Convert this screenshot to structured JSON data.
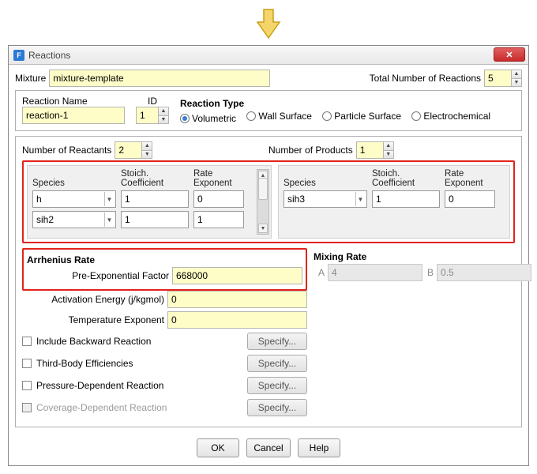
{
  "window": {
    "title": "Reactions",
    "icon_letter": "F"
  },
  "top": {
    "mixture_label": "Mixture",
    "mixture_value": "mixture-template",
    "total_label": "Total Number of Reactions",
    "total_value": "5"
  },
  "reaction": {
    "name_label": "Reaction Name",
    "name_value": "reaction-1",
    "id_label": "ID",
    "id_value": "1",
    "type_label": "Reaction Type",
    "types": {
      "volumetric": "Volumetric",
      "wall": "Wall Surface",
      "particle": "Particle Surface",
      "electro": "Electrochemical"
    }
  },
  "counts": {
    "reactants_label": "Number of Reactants",
    "reactants_value": "2",
    "products_label": "Number of Products",
    "products_value": "1"
  },
  "columns": {
    "species": "Species",
    "stoich": "Stoich.\nCoefficient",
    "rate": "Rate\nExponent",
    "stoich_l1": "Stoich.",
    "stoich_l2": "Coefficient",
    "rate_l1": "Rate",
    "rate_l2": "Exponent"
  },
  "reactants": [
    {
      "species": "h",
      "coeff": "1",
      "exp": "0"
    },
    {
      "species": "sih2",
      "coeff": "1",
      "exp": "1"
    }
  ],
  "products": [
    {
      "species": "sih3",
      "coeff": "1",
      "exp": "0"
    }
  ],
  "arrhenius": {
    "title": "Arrhenius Rate",
    "preexp_label": "Pre-Exponential Factor",
    "preexp_value": "668000",
    "activation_label": "Activation Energy (j/kgmol)",
    "activation_value": "0",
    "tempexp_label": "Temperature Exponent",
    "tempexp_value": "0"
  },
  "mixing": {
    "title": "Mixing Rate",
    "a_label": "A",
    "a_value": "4",
    "b_label": "B",
    "b_value": "0.5"
  },
  "options": {
    "backward": "Include Backward Reaction",
    "third": "Third-Body Efficiencies",
    "pressure": "Pressure-Dependent Reaction",
    "coverage": "Coverage-Dependent Reaction",
    "specify": "Specify..."
  },
  "footer": {
    "ok": "OK",
    "cancel": "Cancel",
    "help": "Help"
  }
}
